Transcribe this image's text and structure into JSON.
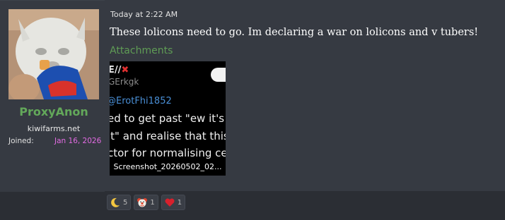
{
  "user": {
    "name": "ProxyAnon",
    "title": "kiwifarms.net",
    "joined_label": "Joined:",
    "joined_value": "Jan 16, 2026"
  },
  "post": {
    "timestamp": "Today at 2:22 AM",
    "message": "These lolicons need to go. Im declaring a war on lolicons and v tubers!",
    "attachments_title": "Attachments"
  },
  "attachment": {
    "filename": "Screenshot_20260502_02...",
    "thumb_name": "E//",
    "thumb_handle": "GErkgk",
    "thumb_mention": "@ErotFhi1852",
    "thumb_line1": "ed to get past \"ew it's ic",
    "thumb_line2": "it\" and realise that this",
    "thumb_line3": "ctor for normalising ce"
  },
  "reactions": [
    {
      "icon": "moon-icon",
      "count": "5"
    },
    {
      "icon": "clown-icon",
      "count": "1"
    },
    {
      "icon": "heart-icon",
      "count": "1"
    }
  ],
  "colors": {
    "username": "#63a85a",
    "joined_value": "#e36be3",
    "attachments_title": "#5f9c55",
    "panel": "#363a42",
    "background": "#2b2e34"
  }
}
